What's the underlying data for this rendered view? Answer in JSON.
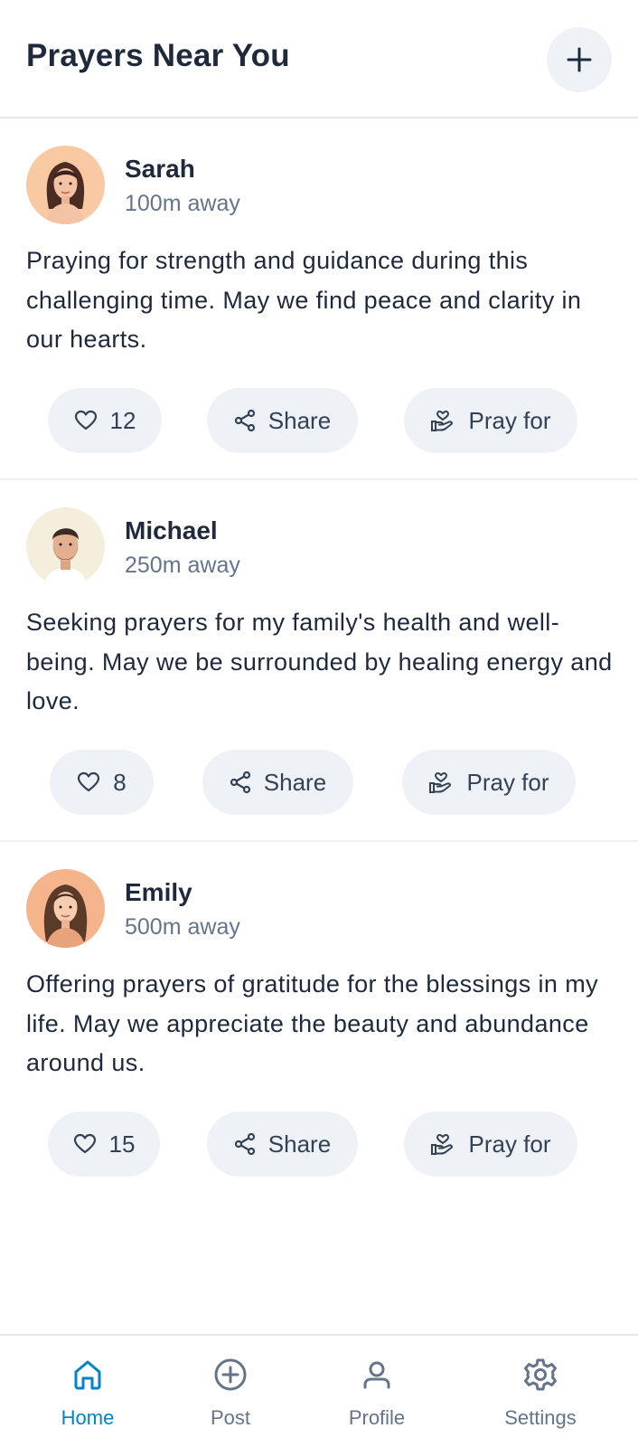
{
  "header": {
    "title": "Prayers Near You",
    "add_icon": "plus-icon"
  },
  "posts": [
    {
      "name": "Sarah",
      "distance": "100m away",
      "text": "Praying for strength and guidance during this challenging time. May we find peace and clarity in our hearts.",
      "likes": "12",
      "share_label": "Share",
      "pray_label": "Pray for",
      "avatar": "woman-dark-hair-avatar"
    },
    {
      "name": "Michael",
      "distance": "250m away",
      "text": "Seeking prayers for my family's health and well-being. May we be surrounded by healing energy and love.",
      "likes": "8",
      "share_label": "Share",
      "pray_label": "Pray for",
      "avatar": "bearded-man-avatar"
    },
    {
      "name": "Emily",
      "distance": "500m away",
      "text": "Offering prayers of gratitude for the blessings in my life. May we appreciate the beauty and abundance around us.",
      "likes": "15",
      "share_label": "Share",
      "pray_label": "Pray for",
      "avatar": "woman-brown-hair-avatar"
    }
  ],
  "nav": {
    "items": [
      {
        "label": "Home",
        "icon": "home-icon",
        "active": true
      },
      {
        "label": "Post",
        "icon": "plus-circle-icon",
        "active": false
      },
      {
        "label": "Profile",
        "icon": "user-icon",
        "active": false
      },
      {
        "label": "Settings",
        "icon": "gear-icon",
        "active": false
      }
    ]
  },
  "colors": {
    "accent": "#0284c7",
    "text": "#1e293b",
    "muted": "#64748b",
    "pill_bg": "#eef2f7"
  }
}
